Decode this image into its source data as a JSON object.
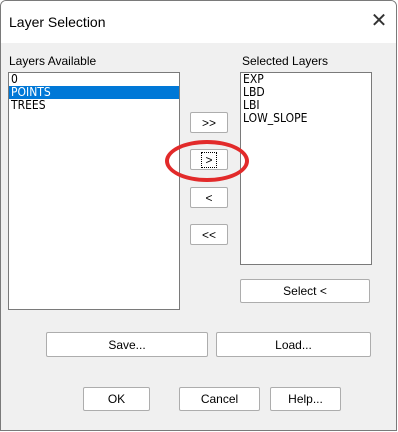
{
  "window": {
    "title": "Layer Selection",
    "close_icon": "close-icon"
  },
  "available": {
    "label": "Layers Available",
    "items": [
      "0",
      "POINTS",
      "TREES"
    ],
    "selected_index": 1
  },
  "selected": {
    "label": "Selected Layers",
    "items": [
      "EXP",
      "LBD",
      "LBI",
      "LOW_SLOPE"
    ]
  },
  "transfer": {
    "add_all": ">>",
    "add": ">",
    "remove": "<",
    "remove_all": "<<"
  },
  "buttons": {
    "select": "Select <",
    "save": "Save...",
    "load": "Load...",
    "ok": "OK",
    "cancel": "Cancel",
    "help": "Help..."
  },
  "colors": {
    "selection": "#0078d7",
    "annotation": "#e22a2a"
  }
}
